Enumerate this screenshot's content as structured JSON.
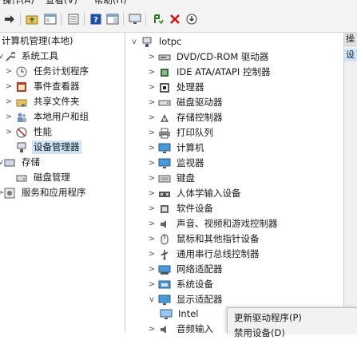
{
  "menu": [
    "操作(A)",
    "查看(V)",
    "帮助(H)"
  ],
  "left_tree": [
    {
      "label": "计算机管理(本地)",
      "arrow": "",
      "icon": "computer-mgmt-icon"
    },
    {
      "label": "系统工具",
      "arrow": "v",
      "icon": "tools-icon"
    },
    {
      "label": "任务计划程序",
      "arrow": ">",
      "icon": "clock-icon"
    },
    {
      "label": "事件查看器",
      "arrow": ">",
      "icon": "event-icon"
    },
    {
      "label": "共享文件夹",
      "arrow": ">",
      "icon": "shared-folder-icon"
    },
    {
      "label": "本地用户和组",
      "arrow": ">",
      "icon": "users-icon"
    },
    {
      "label": "性能",
      "arrow": ">",
      "icon": "performance-icon"
    },
    {
      "label": "设备管理器",
      "arrow": "",
      "icon": "device-manager-icon"
    },
    {
      "label": "存储",
      "arrow": "v",
      "icon": "storage-icon"
    },
    {
      "label": "磁盘管理",
      "arrow": "",
      "icon": "disk-mgmt-icon"
    },
    {
      "label": "服务和应用程序",
      "arrow": ">",
      "icon": "services-icon"
    }
  ],
  "device_tree": {
    "root": "lotpc",
    "categories": [
      {
        "label": "DVD/CD-ROM 驱动器",
        "arrow": ">",
        "icon": "dvd-icon"
      },
      {
        "label": "IDE ATA/ATAPI 控制器",
        "arrow": ">",
        "icon": "ide-icon"
      },
      {
        "label": "处理器",
        "arrow": ">",
        "icon": "processor-icon"
      },
      {
        "label": "磁盘驱动器",
        "arrow": ">",
        "icon": "disk-icon"
      },
      {
        "label": "存储控制器",
        "arrow": ">",
        "icon": "storage-controller-icon"
      },
      {
        "label": "打印队列",
        "arrow": ">",
        "icon": "printer-icon"
      },
      {
        "label": "计算机",
        "arrow": ">",
        "icon": "monitor-icon"
      },
      {
        "label": "监视器",
        "arrow": ">",
        "icon": "monitor-icon"
      },
      {
        "label": "键盘",
        "arrow": ">",
        "icon": "keyboard-icon"
      },
      {
        "label": "人体学输入设备",
        "arrow": ">",
        "icon": "hid-icon"
      },
      {
        "label": "软件设备",
        "arrow": ">",
        "icon": "software-icon"
      },
      {
        "label": "声音、视频和游戏控制器",
        "arrow": ">",
        "icon": "sound-icon"
      },
      {
        "label": "鼠标和其他指针设备",
        "arrow": ">",
        "icon": "mouse-icon"
      },
      {
        "label": "通用串行总线控制器",
        "arrow": ">",
        "icon": "usb-icon"
      },
      {
        "label": "网络适配器",
        "arrow": ">",
        "icon": "network-icon"
      },
      {
        "label": "系统设备",
        "arrow": ">",
        "icon": "system-icon"
      },
      {
        "label": "显示适配器",
        "arrow": "v",
        "icon": "display-icon"
      },
      {
        "label": "Intel",
        "arrow": "",
        "icon": "display-icon"
      },
      {
        "label": "音频输入",
        "arrow": ">",
        "icon": "audio-icon"
      }
    ]
  },
  "actions_pane": {
    "header": "操",
    "item": "设"
  },
  "context_menu": [
    "更新驱动程序(P)",
    "禁用设备(D)"
  ]
}
